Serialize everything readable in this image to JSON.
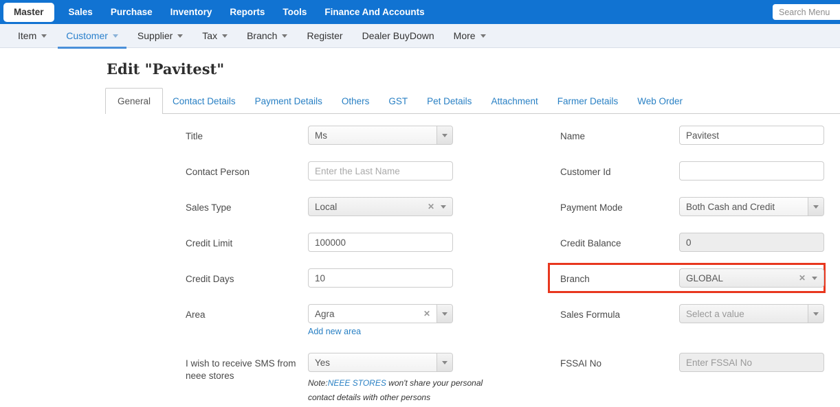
{
  "topnav": {
    "items": [
      {
        "label": "Master"
      },
      {
        "label": "Sales"
      },
      {
        "label": "Purchase"
      },
      {
        "label": "Inventory"
      },
      {
        "label": "Reports"
      },
      {
        "label": "Tools"
      },
      {
        "label": "Finance And Accounts"
      }
    ],
    "search_placeholder": "Search Menu"
  },
  "subnav": {
    "items": [
      {
        "label": "Item"
      },
      {
        "label": "Customer"
      },
      {
        "label": "Supplier"
      },
      {
        "label": "Tax"
      },
      {
        "label": "Branch"
      },
      {
        "label": "Register"
      },
      {
        "label": "Dealer BuyDown"
      },
      {
        "label": "More"
      }
    ]
  },
  "page": {
    "title": "Edit \"Pavitest\""
  },
  "tabs": {
    "items": [
      {
        "label": "General"
      },
      {
        "label": "Contact Details"
      },
      {
        "label": "Payment Details"
      },
      {
        "label": "Others"
      },
      {
        "label": "GST"
      },
      {
        "label": "Pet Details"
      },
      {
        "label": "Attachment"
      },
      {
        "label": "Farmer Details"
      },
      {
        "label": "Web Order"
      }
    ]
  },
  "form": {
    "title": {
      "label": "Title",
      "value": "Ms"
    },
    "contact_person": {
      "label": "Contact Person",
      "placeholder": "Enter the Last Name"
    },
    "sales_type": {
      "label": "Sales Type",
      "value": "Local"
    },
    "credit_limit": {
      "label": "Credit Limit",
      "value": "100000"
    },
    "credit_days": {
      "label": "Credit Days",
      "value": "10"
    },
    "area": {
      "label": "Area",
      "value": "Agra",
      "add_link": "Add new area"
    },
    "sms": {
      "label": "I wish to receive SMS from neee stores",
      "value": "Yes",
      "note_prefix": "Note:",
      "note_link": "NEEE STORES",
      "note_suffix": " won't share your personal contact details with other persons"
    },
    "name": {
      "label": "Name",
      "value": "Pavitest"
    },
    "customer_id": {
      "label": "Customer Id",
      "value": ""
    },
    "payment_mode": {
      "label": "Payment Mode",
      "value": "Both Cash and Credit"
    },
    "credit_balance": {
      "label": "Credit Balance",
      "value": "0"
    },
    "branch": {
      "label": "Branch",
      "value": "GLOBAL"
    },
    "sales_formula": {
      "label": "Sales Formula",
      "placeholder": "Select a value"
    },
    "fssai": {
      "label": "FSSAI No",
      "placeholder": "Enter FSSAI No"
    }
  },
  "colors": {
    "topnav_blue": "#1173d2",
    "accent_blue": "#2980c4",
    "highlight_red": "#e8371e"
  }
}
